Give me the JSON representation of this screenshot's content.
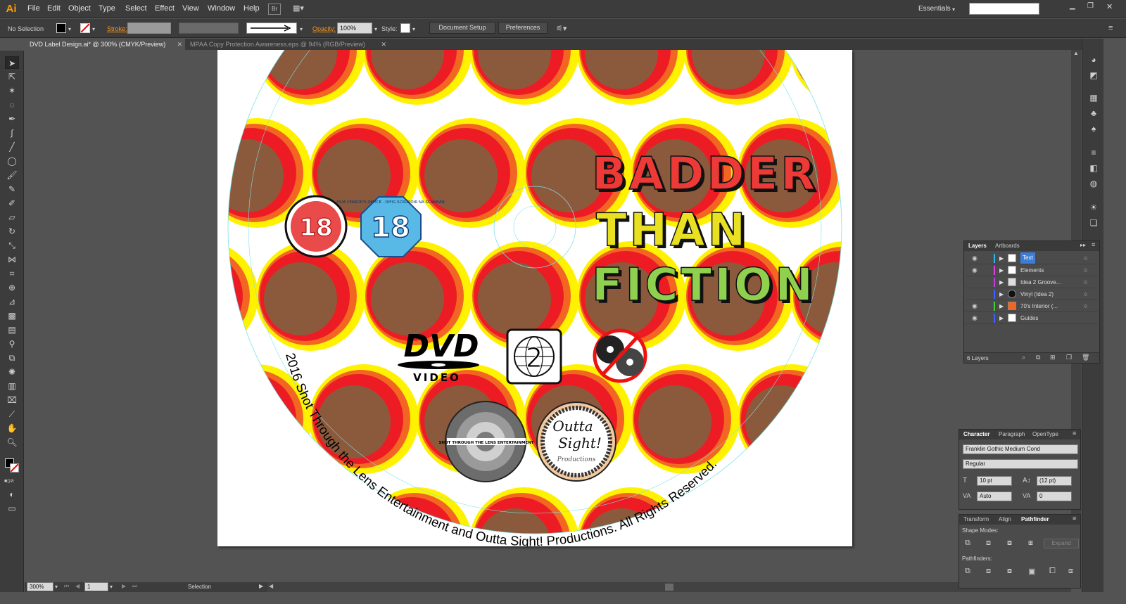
{
  "app": {
    "logo": "Ai"
  },
  "menu": {
    "items": [
      "File",
      "Edit",
      "Object",
      "Type",
      "Select",
      "Effect",
      "View",
      "Window",
      "Help"
    ],
    "br": "Br",
    "workspace": "Essentials"
  },
  "control": {
    "selection": "No Selection",
    "stroke_label": "Stroke:",
    "opacity_label": "Opacity:",
    "opacity_value": "100%",
    "style_label": "Style:",
    "document_setup": "Document Setup",
    "preferences": "Preferences"
  },
  "tabs": [
    {
      "label": "DVD Label Design.ai* @ 300% (CMYK/Preview)"
    },
    {
      "label": "MPAA Copy Protection Awareness.eps @ 94% (RGB/Preview)"
    }
  ],
  "design": {
    "title_lines": [
      "BADDER",
      "THAN",
      "FICTION"
    ],
    "title_colors": [
      "#ee3a37",
      "#e8e020",
      "#8fd14f"
    ],
    "rating_left": "18",
    "rating_right": "18",
    "censor_text": "FILM CENSOR'S OFFICE · OIFIG SCRÚDÓIR NA SCANNÁN",
    "dvd_logo": "DVD",
    "dvd_sub": "VIDEO",
    "region": "2",
    "studio_text": "SHOT THROUGH THE LENS ENTERTAINMENT",
    "outta_line1": "Outta",
    "outta_line2": "Sight!",
    "outta_line3": "Productions",
    "copyright": "2016 Shot Through the Lens Entertainment  and Outta Sight! Productions. All Rights Reserved.",
    "pattern_colors": {
      "yellow": "#fff200",
      "orange": "#f26522",
      "red": "#ed1c24",
      "brown": "#8b5a3c"
    }
  },
  "layers_panel": {
    "tabs": [
      "Layers",
      "Artboards"
    ],
    "rows": [
      {
        "name": "Text",
        "color": "#2db5f5",
        "visible": true,
        "selected": true
      },
      {
        "name": "Elements",
        "color": "#e040e0",
        "visible": true,
        "selected": false
      },
      {
        "name": "Idea 2 Groove...",
        "color": "#c040e0",
        "visible": false,
        "selected": false
      },
      {
        "name": "Vinyl (Idea 2)",
        "color": "#4060ff",
        "visible": false,
        "selected": false
      },
      {
        "name": "70's Interior (...",
        "color": "#40d040",
        "visible": true,
        "selected": false
      },
      {
        "name": "Guides",
        "color": "#4060ff",
        "visible": true,
        "selected": false
      }
    ],
    "count": "6 Layers"
  },
  "character_panel": {
    "tabs": [
      "Character",
      "Paragraph",
      "OpenType"
    ],
    "font": "Franklin Gothic Medium Cond",
    "style": "Regular",
    "size": "10 pt",
    "leading": "(12 pt)",
    "kerning": "Auto",
    "tracking": "0"
  },
  "pathfinder_panel": {
    "tabs": [
      "Transform",
      "Align",
      "Pathfinder"
    ],
    "shape_modes": "Shape Modes:",
    "pathfinders": "Pathfinders:",
    "expand": "Expand"
  },
  "status": {
    "zoom": "300%",
    "artboard": "1",
    "tool": "Selection"
  }
}
